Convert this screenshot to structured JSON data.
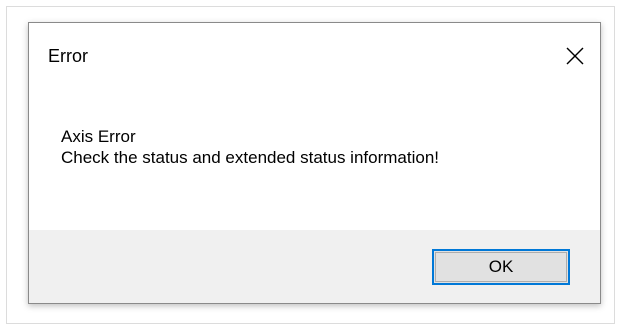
{
  "dialog": {
    "title": "Error",
    "close_icon": "close-icon",
    "message_line1": "Axis Error",
    "message_line2": "Check the status and extended status information!",
    "ok_label": "OK"
  },
  "colors": {
    "button_focus_border": "#0078d7",
    "footer_background": "#f0f0f0",
    "button_background": "#e1e1e1"
  }
}
